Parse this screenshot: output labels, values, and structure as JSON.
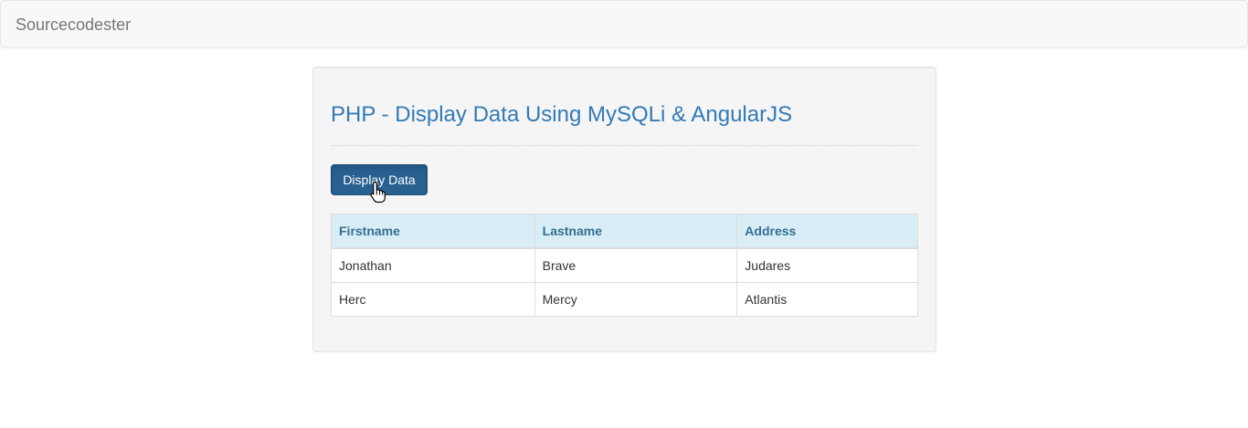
{
  "navbar": {
    "brand": "Sourcecodester"
  },
  "main": {
    "title": "PHP - Display Data Using MySQLi & AngularJS",
    "display_button_label": "Display Data",
    "table": {
      "headers": [
        "Firstname",
        "Lastname",
        "Address"
      ],
      "rows": [
        [
          "Jonathan",
          "Brave",
          "Judares"
        ],
        [
          "Herc",
          "Mercy",
          "Atlantis"
        ]
      ]
    }
  },
  "colors": {
    "title": "#337ab7",
    "button": "#286090",
    "table_header_bg": "#d9edf7",
    "table_header_text": "#31708f"
  },
  "cursor": "hand-pointer-icon"
}
